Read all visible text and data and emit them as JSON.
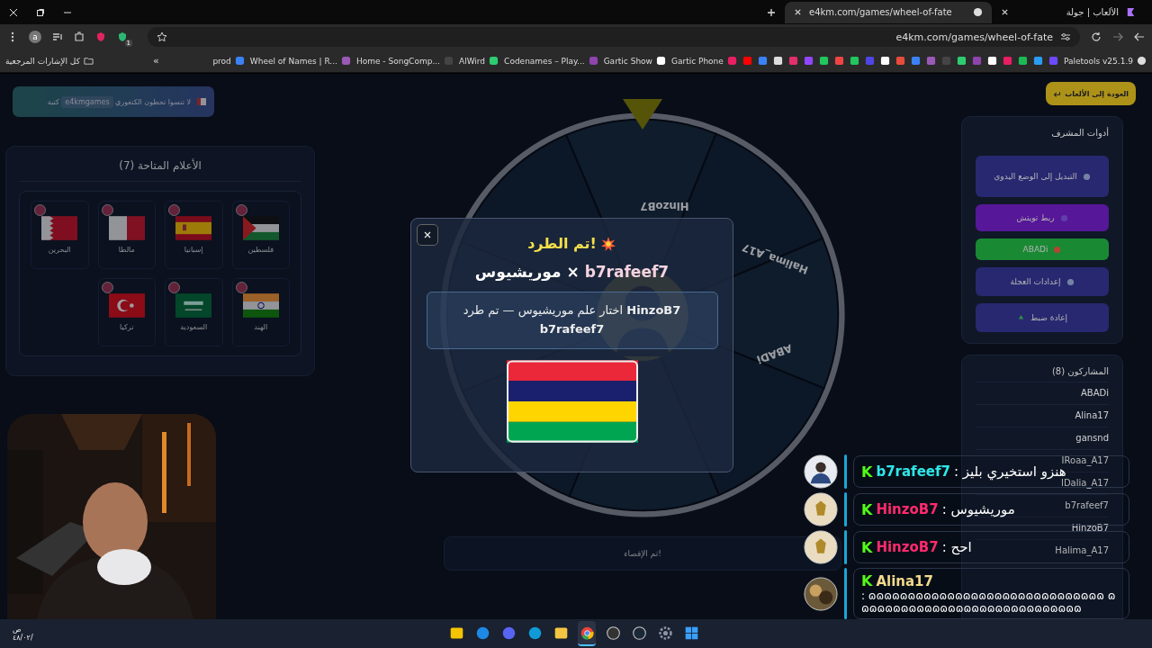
{
  "browser": {
    "tabs": [
      {
        "title": "الألعاب | جولة",
        "selected": false
      },
      {
        "title": "e4km.com/games/wheel-of-fate",
        "selected": true
      }
    ],
    "profile_initial": "a",
    "extension_badge": "1",
    "url": "e4km.com/games/wheel-of-fate",
    "extension_label": "Paletools v25.1.9",
    "bookmarks": [
      "Gartic Phone",
      "Gartic Show",
      "Codenames – Play...",
      "AlWird",
      "Home - SongComp...",
      "Wheel of Names | R...",
      "prod"
    ],
    "bookmarks_more": "»",
    "bookmarks_all": "كل الإشارات المرجعية"
  },
  "page": {
    "notice": {
      "before": "لا تنسوا تحطون الكتغوري",
      "code": "e4kmgames",
      "after": "كتبة"
    },
    "flags_panel": {
      "title": "الأعلام المتاحة (7)",
      "flags": [
        {
          "name": "فلسطين",
          "kind": "palestine"
        },
        {
          "name": "إسبانيا",
          "kind": "spain"
        },
        {
          "name": "مالطا",
          "kind": "malta"
        },
        {
          "name": "البحرين",
          "kind": "bahrain"
        },
        {
          "name": "الهند",
          "kind": "india"
        },
        {
          "name": "السعودية",
          "kind": "saudi"
        },
        {
          "name": "تركيا",
          "kind": "turkey"
        }
      ]
    },
    "wheel": {
      "labels": [
        "HinzoB7",
        "Halima_A17",
        "ABADi"
      ]
    },
    "result": "تم الإقصاء!",
    "back_button": "العودة إلى الألعاب",
    "admin": {
      "title": "أدوات المشرف",
      "buttons": [
        {
          "label": "التبديل إلى الوضع اليدوي",
          "kind": "manual"
        },
        {
          "label": "ربط تويتش",
          "kind": "twitch"
        },
        {
          "label": "ABADi",
          "kind": "player"
        },
        {
          "label": "إعدادات العجلة",
          "kind": "settings"
        },
        {
          "label": "إعادة ضبط",
          "kind": "reset"
        }
      ]
    },
    "participants": {
      "title": "المشاركون (8)",
      "names": [
        "ABADi",
        "Alina17",
        "gansnd",
        "IRoaa_A17",
        "IDalia_A17",
        "b7rafeef7",
        "HinzoB7",
        "Halima_A17"
      ]
    },
    "modal": {
      "title": "تم الطرد!",
      "player": "b7rafeef7",
      "separator": "×",
      "country": "موريشيوس",
      "message": "**HinzoB7** اختار علم موريشيوس — تم طرد **b7rafeef7**",
      "flag": {
        "kind": "mauritius"
      }
    }
  },
  "chat": [
    {
      "badge": "K",
      "user": "b7rafeef7",
      "color": "#2ee8e8",
      "sep": ":",
      "text": "هنزو استخيري بليز",
      "kind": "person"
    },
    {
      "badge": "K",
      "user": "HinzoB7",
      "color": "#ff2a6d",
      "sep": ":",
      "text": "موريشيوس",
      "kind": "emblem"
    },
    {
      "badge": "K",
      "user": "HinzoB7",
      "color": "#ff2a6d",
      "sep": ":",
      "text": "احح",
      "kind": "emblem"
    },
    {
      "badge": "K",
      "user": "Alina17",
      "color": "#f2d98a",
      "sep": ":",
      "text": "ɷɷɷɷɷɷɷɷɷɷɷɷɷɷɷɷɷɷɷɷɷɷɷɷɷɷɷɷɷɷ ɷɷɷɷɷɷɷɷɷɷɷɷɷɷɷɷɷɷɷɷɷɷɷɷɷɷɷɷɷ"
    }
  ],
  "taskbar": {
    "clock": [
      "ص",
      "٤٨/٠٢/"
    ],
    "apps": [
      {
        "kind": "rockstar",
        "selected": false
      },
      {
        "kind": "blue",
        "selected": false
      },
      {
        "kind": "discord",
        "selected": false
      },
      {
        "kind": "edge",
        "selected": false
      },
      {
        "kind": "folder",
        "selected": false
      },
      {
        "kind": "chrome",
        "selected": true
      },
      {
        "kind": "obs",
        "selected": false
      },
      {
        "kind": "steam",
        "selected": false
      },
      {
        "kind": "gear",
        "selected": false
      },
      {
        "kind": "windows",
        "selected": false
      }
    ]
  }
}
